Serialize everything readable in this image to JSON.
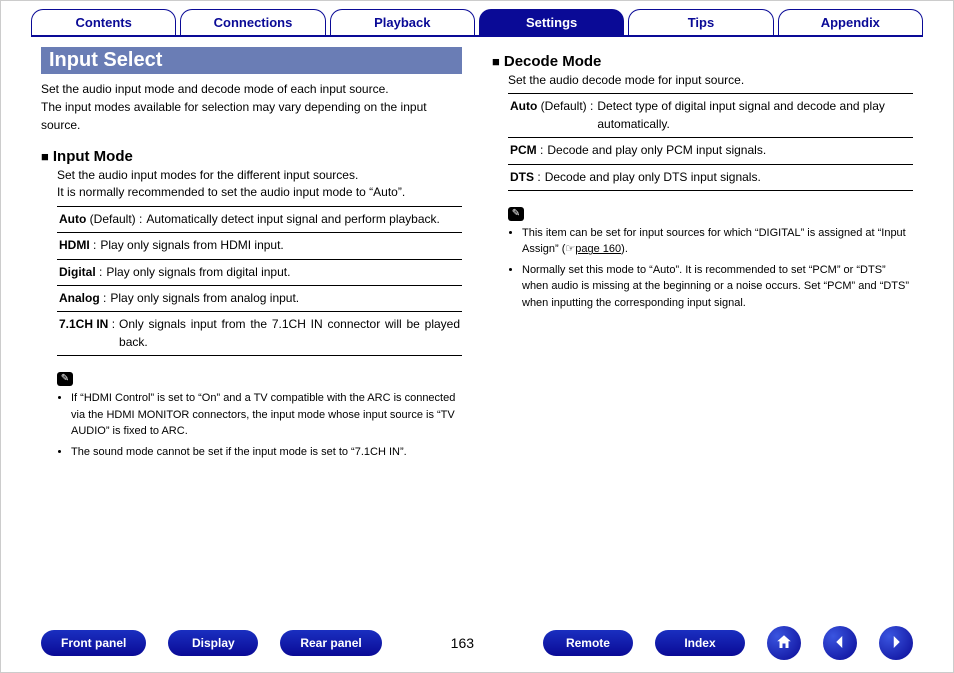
{
  "tabs": [
    {
      "label": "Contents",
      "active": false
    },
    {
      "label": "Connections",
      "active": false
    },
    {
      "label": "Playback",
      "active": false
    },
    {
      "label": "Settings",
      "active": true
    },
    {
      "label": "Tips",
      "active": false
    },
    {
      "label": "Appendix",
      "active": false
    }
  ],
  "page_number": "163",
  "left": {
    "title": "Input Select",
    "intro": "Set the audio input mode and decode mode of each input source.\nThe input modes available for selection may vary depending on the input source.",
    "section": {
      "heading": "Input Mode",
      "desc": "Set the audio input modes for the different input sources.\nIt is normally recommended to set the audio input mode to “Auto”.",
      "options": [
        {
          "name": "Auto",
          "suffix": " (Default) ",
          "desc": "Automatically detect input signal and perform playback."
        },
        {
          "name": "HDMI",
          "suffix": " ",
          "desc": "Play only signals from HDMI input."
        },
        {
          "name": "Digital",
          "suffix": " ",
          "desc": "Play only signals from digital input."
        },
        {
          "name": "Analog",
          "suffix": " ",
          "desc": "Play only signals from analog input."
        },
        {
          "name": "7.1CH IN",
          "suffix": " ",
          "desc": "Only signals input from the 7.1CH IN connector will be played back.",
          "justify": true
        }
      ],
      "notes": [
        "If “HDMI Control” is set to “On” and a TV compatible with the ARC is connected via the HDMI MONITOR connectors, the input mode whose input source is “TV AUDIO” is fixed to ARC.",
        "The sound mode cannot be set if the input mode is set to “7.1CH IN”."
      ]
    }
  },
  "right": {
    "section": {
      "heading": "Decode Mode",
      "desc": "Set the audio decode mode for input source.",
      "options": [
        {
          "name": "Auto",
          "suffix": " (Default) ",
          "desc": "Detect type of digital input signal and decode and play automatically."
        },
        {
          "name": "PCM",
          "suffix": " ",
          "desc": "Decode and play only PCM input signals."
        },
        {
          "name": "DTS",
          "suffix": " ",
          "desc": "Decode and play only DTS input signals."
        }
      ],
      "notes_pre": "This item can be set for input sources for which “DIGITAL” is assigned at “Input Assign” (",
      "notes_link": "page 160",
      "notes_post": ").",
      "notes2": "Normally set this mode to “Auto”. It is recommended to set “PCM” or “DTS” when audio is missing at the beginning or a noise occurs. Set “PCM” and “DTS” when inputting the corresponding input signal."
    }
  },
  "footer": {
    "left_buttons": [
      "Front panel",
      "Display",
      "Rear panel"
    ],
    "right_buttons": [
      "Remote",
      "Index"
    ]
  }
}
